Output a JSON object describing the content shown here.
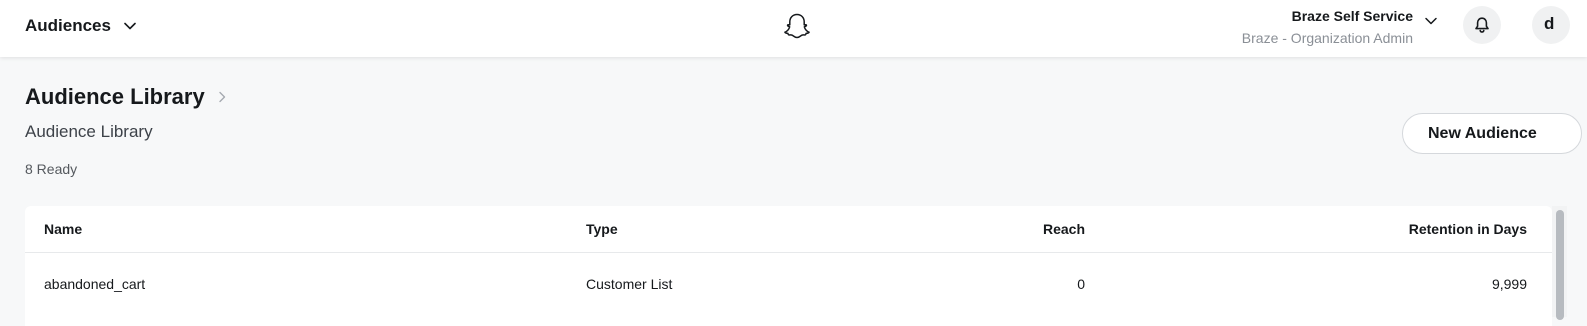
{
  "header": {
    "title": "Audiences",
    "title_icon": "chevron-down-icon",
    "logo": "snapchat-ghost-logo",
    "account_name": "Braze Self Service",
    "account_role": "Braze - Organization Admin",
    "account_icon": "chevron-down-icon",
    "notifications_icon": "bell-icon",
    "avatar_initial": "d"
  },
  "page": {
    "title": "Audience Library",
    "breadcrumb_icon": "chevron-right-icon",
    "subtitle": "Audience Library",
    "status": "8 Ready",
    "new_button": "New Audience"
  },
  "table": {
    "columns": [
      "Name",
      "Type",
      "Reach",
      "Retention in Days"
    ],
    "rows": [
      {
        "name": "abandoned_cart",
        "type": "Customer List",
        "reach": "0",
        "retention": "9,999"
      }
    ]
  },
  "colors": {
    "background": "#f7f8f9",
    "surface": "#ffffff",
    "text": "#16191c",
    "muted_text": "#8a8f96"
  }
}
